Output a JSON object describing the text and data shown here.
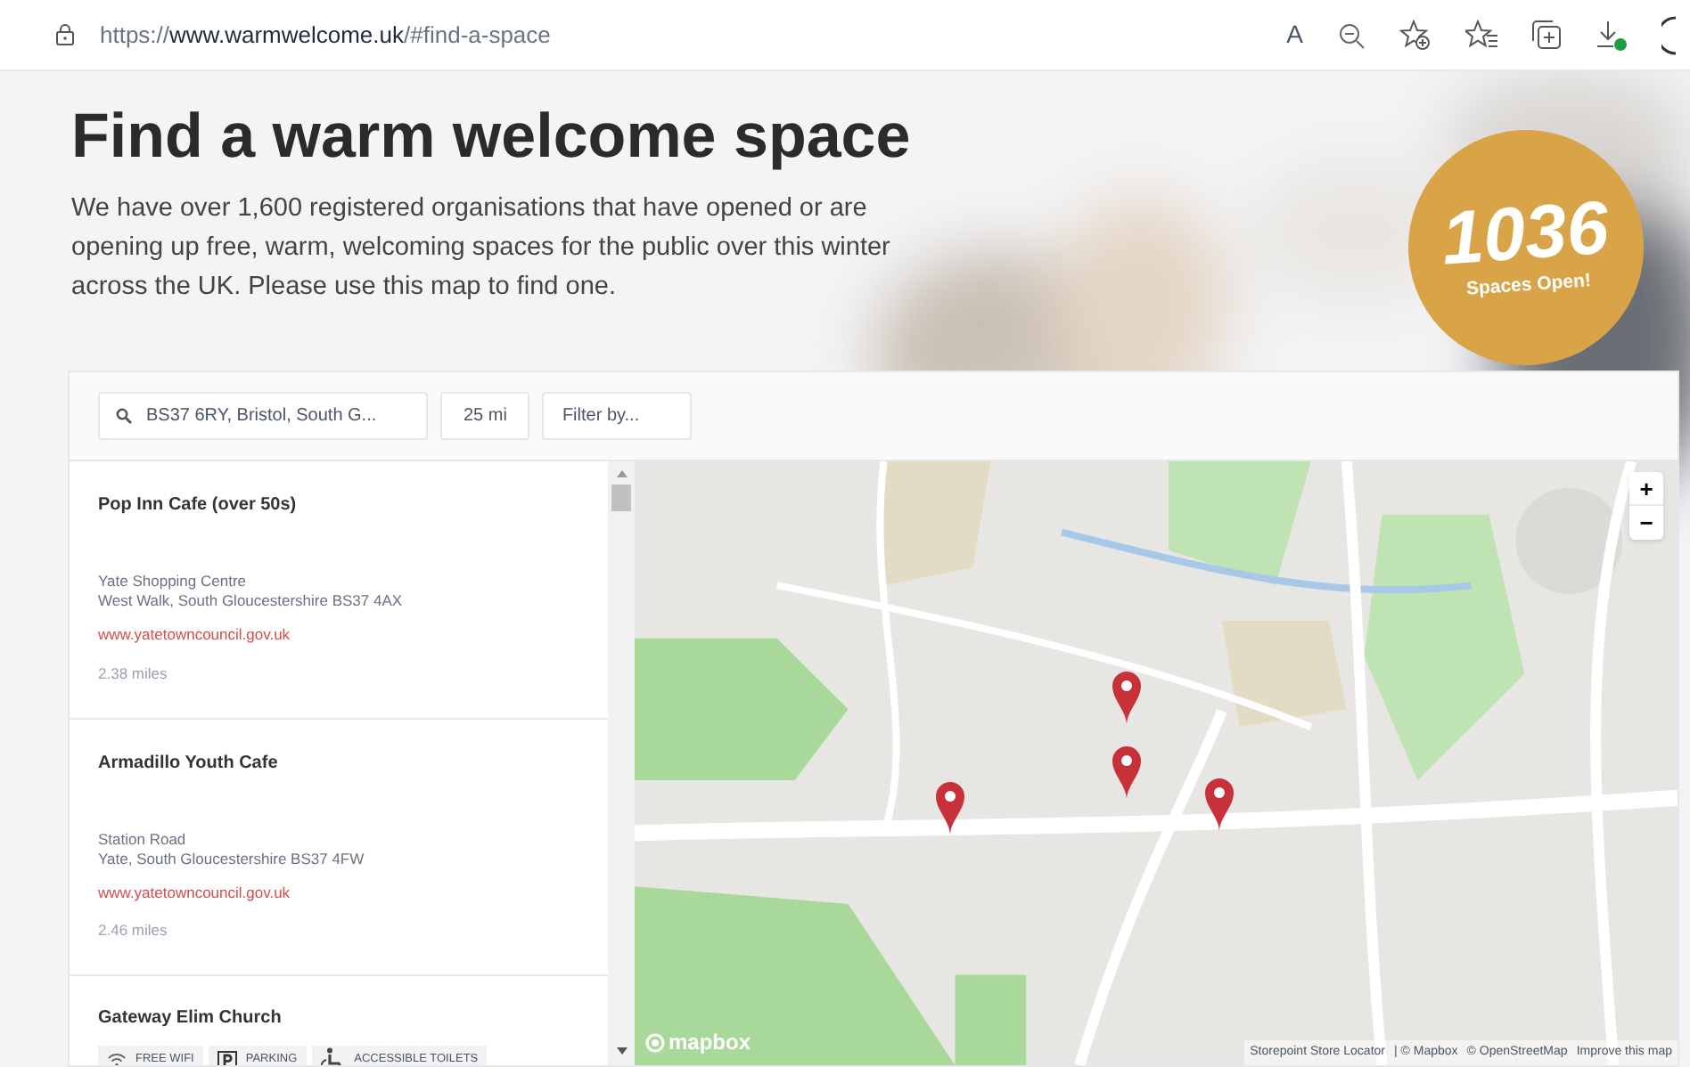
{
  "browser": {
    "url": {
      "scheme": "https://",
      "host": "www.warmwelcome.uk",
      "path": "/#find-a-space"
    },
    "read_aloud": "A"
  },
  "hero": {
    "title": "Find a warm welcome space",
    "intro": "We have over 1,600 registered organisations that have opened or are opening up free, warm, welcoming spaces for the public over this winter across the UK. Please use this map to find one.",
    "badge": {
      "count": "1036",
      "caption": "Spaces Open!"
    }
  },
  "search": {
    "value": "BS37 6RY, Bristol, South G...",
    "radius": "25 mi",
    "filter_placeholder": "Filter by..."
  },
  "listings": [
    {
      "name": "Pop Inn Cafe (over 50s)",
      "address": [
        "Yate Shopping Centre",
        "West Walk, South Gloucestershire BS37 4AX"
      ],
      "website": "www.yatetowncouncil.gov.uk",
      "distance": "2.38 miles"
    },
    {
      "name": "Armadillo Youth Cafe",
      "address": [
        "Station Road",
        "Yate, South Gloucestershire BS37 4FW"
      ],
      "website": "www.yatetowncouncil.gov.uk",
      "distance": "2.46 miles"
    },
    {
      "name": "Gateway Elim Church",
      "amenities": [
        {
          "kind": "wifi",
          "label": "FREE WIFI"
        },
        {
          "kind": "parking",
          "label": "PARKING"
        },
        {
          "kind": "accessible",
          "label": "ACCESSIBLE TOILETS"
        }
      ]
    }
  ],
  "map": {
    "zoom_in": "+",
    "zoom_out": "−",
    "logo": "mapbox",
    "attribution": [
      "Storepoint Store Locator",
      "| © Mapbox",
      "© OpenStreetMap",
      "Improve this map"
    ]
  }
}
